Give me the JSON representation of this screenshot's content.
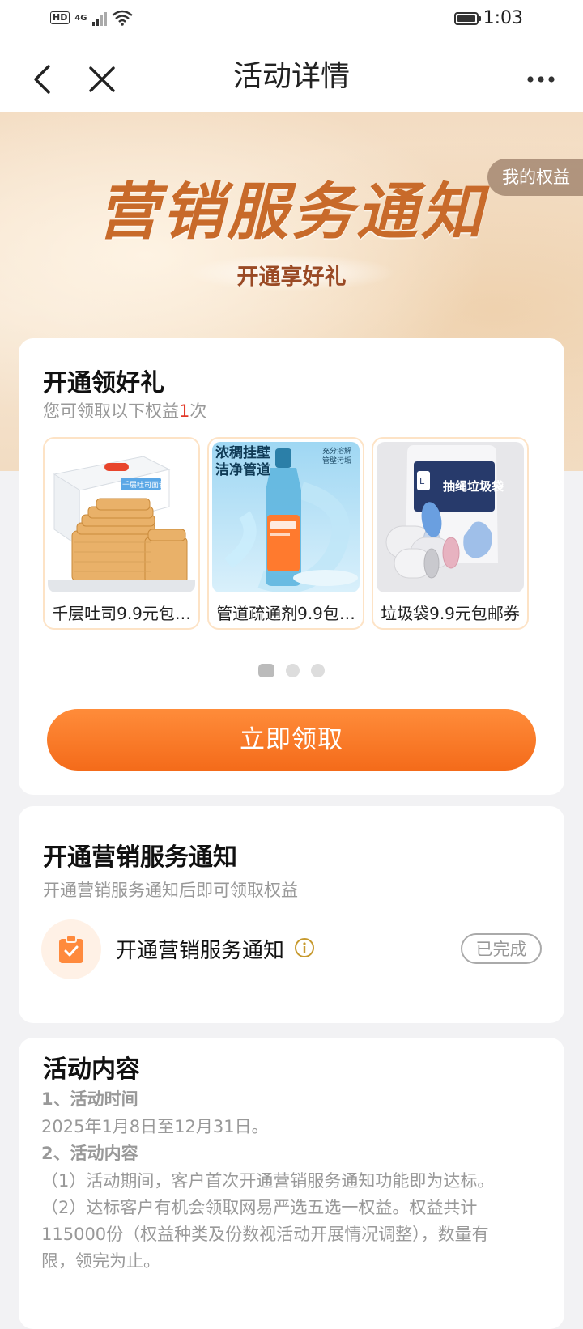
{
  "status_bar": {
    "network_label": "HD",
    "net_type": "4G",
    "time": "1:03"
  },
  "header": {
    "title": "活动详情"
  },
  "banner": {
    "title": "营销服务通知",
    "subtitle": "开通享好礼",
    "my_rights": "我的权益"
  },
  "gift_card": {
    "title": "开通领好礼",
    "subtitle_prefix": "您可领取以下权益",
    "subtitle_count": "1",
    "subtitle_suffix": "次",
    "items": [
      {
        "name": "千层吐司9.9元包…",
        "image_text": "千层吐司面包"
      },
      {
        "name": "管道疏通剂9.9包…",
        "image_text": "浓稠挂壁 洁净管道",
        "image_side_text": "充分溶解 管壁污垢"
      },
      {
        "name": "垃圾袋9.9元包邮券",
        "image_text": "抽绳垃圾袋"
      }
    ],
    "page_indicator": {
      "count": 3,
      "active": 1
    },
    "cta_label": "立即领取"
  },
  "notify_card": {
    "title": "开通营销服务通知",
    "subtitle": "开通营销服务通知后即可领取权益",
    "task_label": "开通营销服务通知",
    "status": "已完成"
  },
  "content_card": {
    "title": "活动内容",
    "lines": [
      "1、活动时间",
      "2025年1月8日至12月31日。",
      "2、活动内容",
      "（1）活动期间，客户首次开通营销服务通知功能即为达标。",
      "（2）达标客户有机会领取网易严选五选一权益。权益共计",
      "115000份（权益种类及份数视活动开展情况调整），数量有",
      "限，领完为止。"
    ]
  },
  "colors": {
    "accent": "#f46b1a",
    "highlight": "#e23a2a",
    "muted": "#999999"
  }
}
